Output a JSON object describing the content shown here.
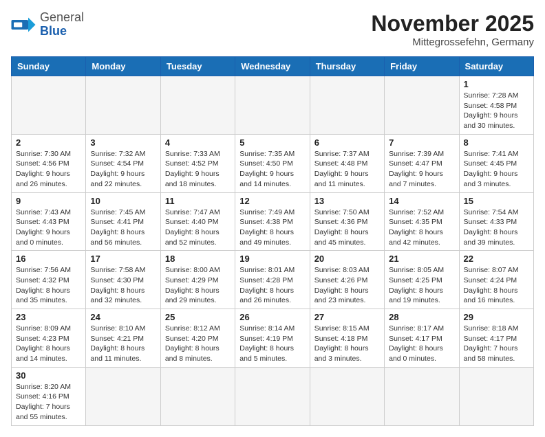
{
  "header": {
    "logo_general": "General",
    "logo_blue": "Blue",
    "month_title": "November 2025",
    "location": "Mittegrossefehn, Germany"
  },
  "days_of_week": [
    "Sunday",
    "Monday",
    "Tuesday",
    "Wednesday",
    "Thursday",
    "Friday",
    "Saturday"
  ],
  "weeks": [
    [
      {
        "day": "",
        "info": ""
      },
      {
        "day": "",
        "info": ""
      },
      {
        "day": "",
        "info": ""
      },
      {
        "day": "",
        "info": ""
      },
      {
        "day": "",
        "info": ""
      },
      {
        "day": "",
        "info": ""
      },
      {
        "day": "1",
        "info": "Sunrise: 7:28 AM\nSunset: 4:58 PM\nDaylight: 9 hours\nand 30 minutes."
      }
    ],
    [
      {
        "day": "2",
        "info": "Sunrise: 7:30 AM\nSunset: 4:56 PM\nDaylight: 9 hours\nand 26 minutes."
      },
      {
        "day": "3",
        "info": "Sunrise: 7:32 AM\nSunset: 4:54 PM\nDaylight: 9 hours\nand 22 minutes."
      },
      {
        "day": "4",
        "info": "Sunrise: 7:33 AM\nSunset: 4:52 PM\nDaylight: 9 hours\nand 18 minutes."
      },
      {
        "day": "5",
        "info": "Sunrise: 7:35 AM\nSunset: 4:50 PM\nDaylight: 9 hours\nand 14 minutes."
      },
      {
        "day": "6",
        "info": "Sunrise: 7:37 AM\nSunset: 4:48 PM\nDaylight: 9 hours\nand 11 minutes."
      },
      {
        "day": "7",
        "info": "Sunrise: 7:39 AM\nSunset: 4:47 PM\nDaylight: 9 hours\nand 7 minutes."
      },
      {
        "day": "8",
        "info": "Sunrise: 7:41 AM\nSunset: 4:45 PM\nDaylight: 9 hours\nand 3 minutes."
      }
    ],
    [
      {
        "day": "9",
        "info": "Sunrise: 7:43 AM\nSunset: 4:43 PM\nDaylight: 9 hours\nand 0 minutes."
      },
      {
        "day": "10",
        "info": "Sunrise: 7:45 AM\nSunset: 4:41 PM\nDaylight: 8 hours\nand 56 minutes."
      },
      {
        "day": "11",
        "info": "Sunrise: 7:47 AM\nSunset: 4:40 PM\nDaylight: 8 hours\nand 52 minutes."
      },
      {
        "day": "12",
        "info": "Sunrise: 7:49 AM\nSunset: 4:38 PM\nDaylight: 8 hours\nand 49 minutes."
      },
      {
        "day": "13",
        "info": "Sunrise: 7:50 AM\nSunset: 4:36 PM\nDaylight: 8 hours\nand 45 minutes."
      },
      {
        "day": "14",
        "info": "Sunrise: 7:52 AM\nSunset: 4:35 PM\nDaylight: 8 hours\nand 42 minutes."
      },
      {
        "day": "15",
        "info": "Sunrise: 7:54 AM\nSunset: 4:33 PM\nDaylight: 8 hours\nand 39 minutes."
      }
    ],
    [
      {
        "day": "16",
        "info": "Sunrise: 7:56 AM\nSunset: 4:32 PM\nDaylight: 8 hours\nand 35 minutes."
      },
      {
        "day": "17",
        "info": "Sunrise: 7:58 AM\nSunset: 4:30 PM\nDaylight: 8 hours\nand 32 minutes."
      },
      {
        "day": "18",
        "info": "Sunrise: 8:00 AM\nSunset: 4:29 PM\nDaylight: 8 hours\nand 29 minutes."
      },
      {
        "day": "19",
        "info": "Sunrise: 8:01 AM\nSunset: 4:28 PM\nDaylight: 8 hours\nand 26 minutes."
      },
      {
        "day": "20",
        "info": "Sunrise: 8:03 AM\nSunset: 4:26 PM\nDaylight: 8 hours\nand 23 minutes."
      },
      {
        "day": "21",
        "info": "Sunrise: 8:05 AM\nSunset: 4:25 PM\nDaylight: 8 hours\nand 19 minutes."
      },
      {
        "day": "22",
        "info": "Sunrise: 8:07 AM\nSunset: 4:24 PM\nDaylight: 8 hours\nand 16 minutes."
      }
    ],
    [
      {
        "day": "23",
        "info": "Sunrise: 8:09 AM\nSunset: 4:23 PM\nDaylight: 8 hours\nand 14 minutes."
      },
      {
        "day": "24",
        "info": "Sunrise: 8:10 AM\nSunset: 4:21 PM\nDaylight: 8 hours\nand 11 minutes."
      },
      {
        "day": "25",
        "info": "Sunrise: 8:12 AM\nSunset: 4:20 PM\nDaylight: 8 hours\nand 8 minutes."
      },
      {
        "day": "26",
        "info": "Sunrise: 8:14 AM\nSunset: 4:19 PM\nDaylight: 8 hours\nand 5 minutes."
      },
      {
        "day": "27",
        "info": "Sunrise: 8:15 AM\nSunset: 4:18 PM\nDaylight: 8 hours\nand 3 minutes."
      },
      {
        "day": "28",
        "info": "Sunrise: 8:17 AM\nSunset: 4:17 PM\nDaylight: 8 hours\nand 0 minutes."
      },
      {
        "day": "29",
        "info": "Sunrise: 8:18 AM\nSunset: 4:17 PM\nDaylight: 7 hours\nand 58 minutes."
      }
    ],
    [
      {
        "day": "30",
        "info": "Sunrise: 8:20 AM\nSunset: 4:16 PM\nDaylight: 7 hours\nand 55 minutes."
      },
      {
        "day": "",
        "info": ""
      },
      {
        "day": "",
        "info": ""
      },
      {
        "day": "",
        "info": ""
      },
      {
        "day": "",
        "info": ""
      },
      {
        "day": "",
        "info": ""
      },
      {
        "day": "",
        "info": ""
      }
    ]
  ]
}
